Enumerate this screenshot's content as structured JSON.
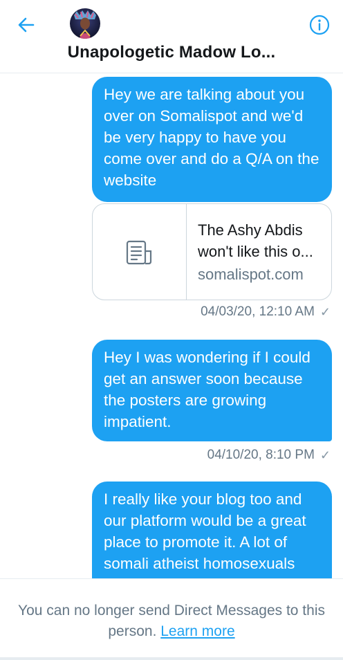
{
  "header": {
    "title": "Unapologetic Madow Lo...",
    "back_icon": "arrow-left-icon",
    "info_icon": "info-icon",
    "accent_color": "#1da1f2"
  },
  "messages": [
    {
      "text": "Hey we are talking about you over on Somalispot and we'd be very happy to have you come over and do a Q/A on the website"
    },
    {
      "text": "Hey I was wondering if I could get an answer soon because the posters are growing impatient."
    },
    {
      "text": "I really like your blog too and our platform would be a great place to promote it. A lot of somali atheist homosexuals"
    }
  ],
  "link_card": {
    "title_line1": "The Ashy Abdis",
    "title_line2": "won't like this o...",
    "domain": "somalispot.com",
    "icon": "article-icon"
  },
  "timestamps": [
    {
      "text": "04/03/20, 12:10 AM",
      "status": "✓"
    },
    {
      "text": "04/10/20, 8:10 PM",
      "status": "✓"
    }
  ],
  "footer": {
    "text": "You can no longer send Direct Messages to this person.",
    "link_label": "Learn more"
  }
}
